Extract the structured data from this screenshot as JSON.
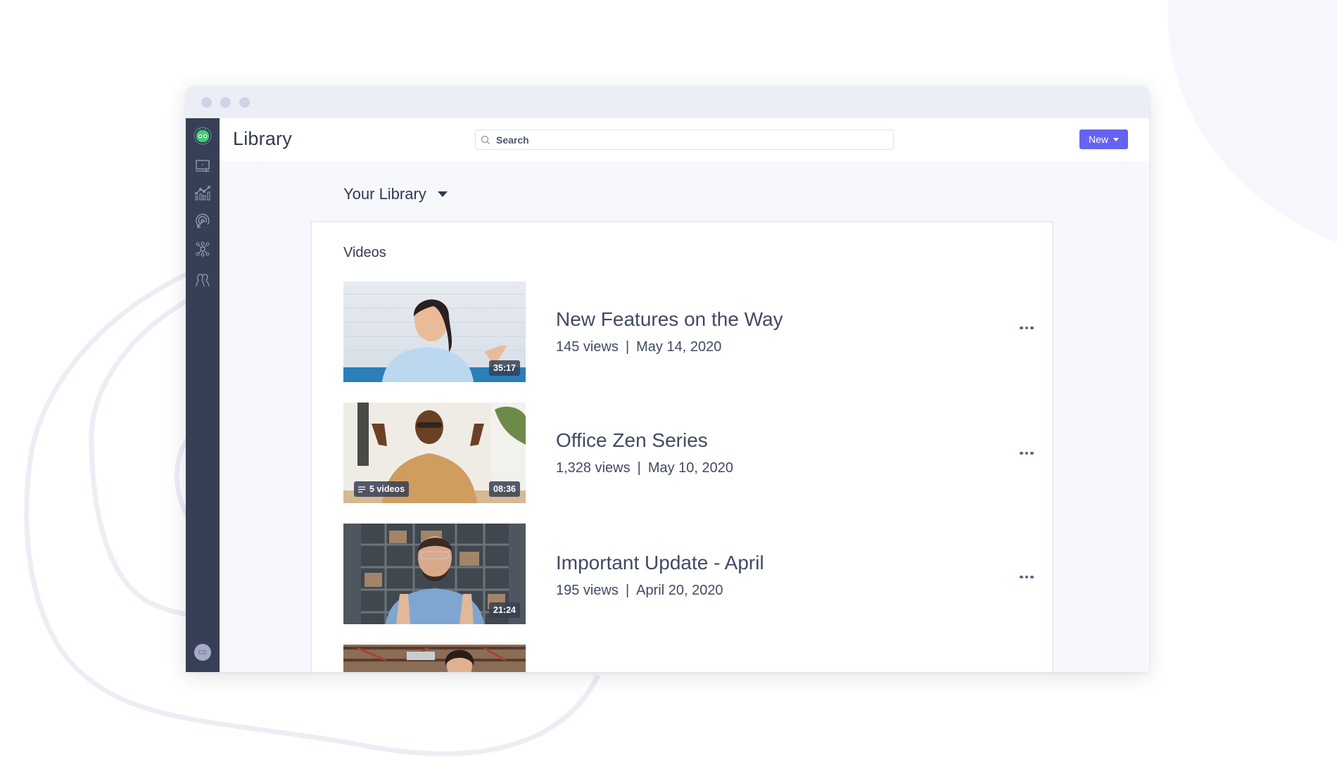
{
  "window": {
    "title_dots": [
      "close",
      "minimize",
      "maximize"
    ]
  },
  "sidebar": {
    "logo_icon": "robot-logo-icon",
    "items": [
      {
        "name": "videos",
        "icon": "video-screen-icon"
      },
      {
        "name": "analytics",
        "icon": "bar-chart-icon"
      },
      {
        "name": "engagement",
        "icon": "target-icon"
      },
      {
        "name": "integrations",
        "icon": "network-icon"
      },
      {
        "name": "team",
        "icon": "users-icon"
      }
    ],
    "avatar_initials": "CD"
  },
  "header": {
    "title": "Library",
    "search": {
      "placeholder": "Search",
      "value": ""
    },
    "new_button_label": "New"
  },
  "library_selector": {
    "label": "Your Library"
  },
  "section": {
    "label": "Videos"
  },
  "videos": [
    {
      "title": "New Features on the Way",
      "views": "145 views",
      "date": "May 14, 2020",
      "duration": "35:17",
      "playlist_count": null
    },
    {
      "title": "Office Zen Series",
      "views": "1,328 views",
      "date": "May 10, 2020",
      "duration": "08:36",
      "playlist_count": "5 videos"
    },
    {
      "title": "Important Update - April",
      "views": "195 views",
      "date": "April 20, 2020",
      "duration": "21:24",
      "playlist_count": null
    },
    {
      "title": "",
      "views": "",
      "date": "",
      "duration": "",
      "playlist_count": null
    }
  ],
  "meta_separator": "|",
  "colors": {
    "accent": "#6663f2",
    "sidebar": "#373f55",
    "logo_green": "#3ecf6e",
    "text_primary": "#323a50"
  }
}
